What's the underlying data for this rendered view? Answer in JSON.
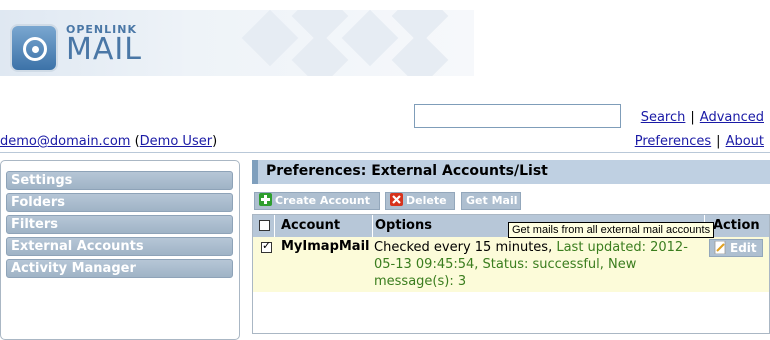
{
  "logo": {
    "line1": "OPENLINK",
    "line2": "MAIL"
  },
  "search": {
    "value": "",
    "search_link": "Search",
    "advanced_link": "Advanced",
    "separator": "|"
  },
  "user": {
    "email": "demo@domain.com",
    "name_open": "(",
    "name": "Demo User",
    "name_close": ")"
  },
  "top_links": {
    "preferences": "Preferences",
    "about": "About",
    "separator": "|"
  },
  "sidebar": {
    "items": [
      {
        "label": "Settings"
      },
      {
        "label": "Folders"
      },
      {
        "label": "Filters"
      },
      {
        "label": "External Accounts"
      },
      {
        "label": "Activity Manager"
      }
    ]
  },
  "main": {
    "title": "Preferences: External Accounts/List",
    "toolbar": {
      "create": "Create Account",
      "delete": "Delete",
      "get_mail": "Get Mail"
    },
    "table": {
      "headers": {
        "account": "Account",
        "options": "Options",
        "action": "Action"
      },
      "rows": [
        {
          "checked": true,
          "account": "MyImapMail",
          "options_prefix": "Checked every 15 minutes,",
          "options_line1_rest": "Last updated: 2012-",
          "options_line2": "05-13 09:45:54, Status: successful, New",
          "options_line3": "message(s): 3",
          "action": "Edit"
        }
      ]
    }
  },
  "tooltip": "Get mails from all external mail accounts",
  "colors": {
    "accent": "#7f9fbd",
    "sidebar_btn": "#a9bccd",
    "row_highlight": "#fcfbd9",
    "green_text": "#3a7d1e",
    "link": "#1a1aa6"
  }
}
